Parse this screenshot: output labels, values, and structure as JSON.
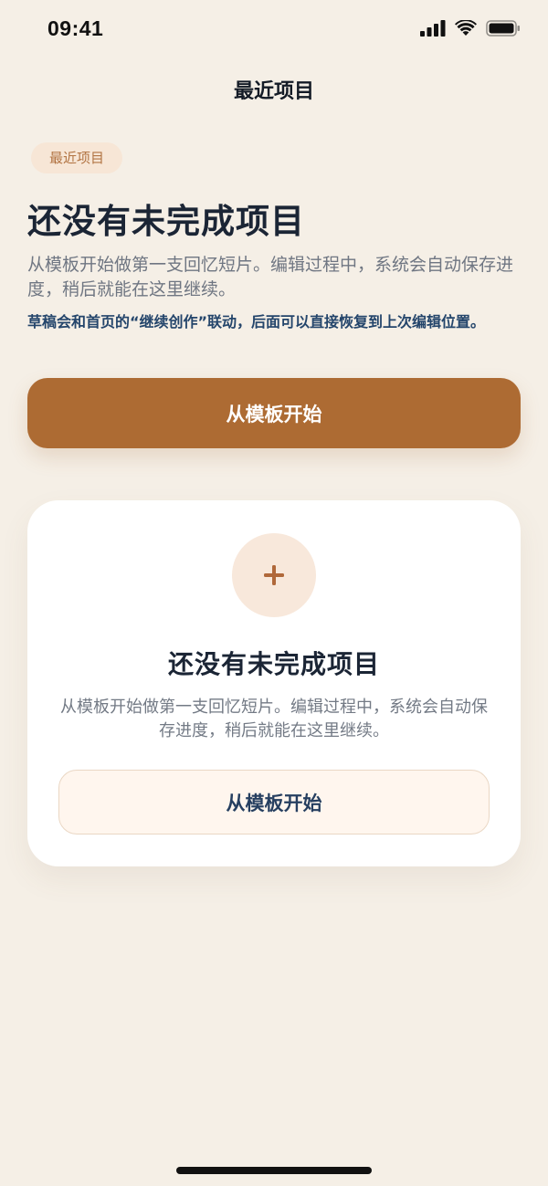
{
  "status_bar": {
    "time": "09:41",
    "icons": [
      "cellular-signal-icon",
      "wifi-icon",
      "battery-icon"
    ]
  },
  "nav": {
    "title": "最近项目"
  },
  "hero": {
    "badge": "最近项目",
    "title": "还没有未完成项目",
    "description": "从模板开始做第一支回忆短片。编辑过程中，系统会自动保存进度，稍后就能在这里继续。",
    "note": "草稿会和首页的“继续创作”联动，后面可以直接恢复到上次编辑位置。",
    "primary_button": "从模板开始"
  },
  "empty_card": {
    "icon": "plus-icon",
    "title": "还没有未完成项目",
    "description": "从模板开始做第一支回忆短片。编辑过程中，系统会自动保存进度，稍后就能在这里继续。",
    "button": "从模板开始"
  },
  "colors": {
    "background": "#f5efe6",
    "accent": "#ad6b33",
    "badge_bg": "#f7e6d6",
    "note_text": "#24456b"
  }
}
